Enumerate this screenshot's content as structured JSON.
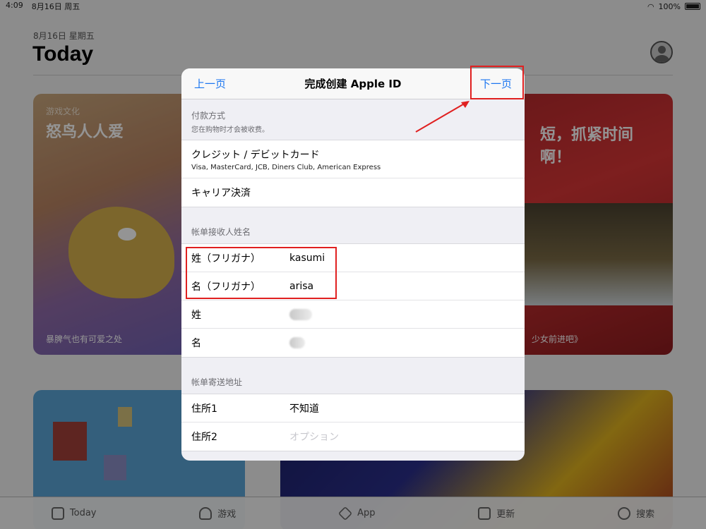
{
  "status_bar": {
    "time": "4:09",
    "date": "8月16日 周五",
    "battery": "100%"
  },
  "header": {
    "date_line": "8月16日 星期五",
    "title": "Today"
  },
  "cards": {
    "left1": {
      "tag": "游戏文化",
      "title": "怒鸟人人爱",
      "bottom": "暴脾气也有可爱之处"
    },
    "right1": {
      "title": "短，抓紧时间\n啊！",
      "bottom": "少女前进吧》"
    }
  },
  "tabbar": {
    "items": [
      {
        "label": "Today",
        "icon": "today-icon"
      },
      {
        "label": "游戏",
        "icon": "rocket-icon"
      },
      {
        "label": "App",
        "icon": "layers-icon"
      },
      {
        "label": "更新",
        "icon": "download-icon"
      },
      {
        "label": "搜索",
        "icon": "search-icon"
      }
    ]
  },
  "modal": {
    "nav": {
      "back_label": "上一页",
      "title": "完成创建 Apple ID",
      "next_label": "下一页"
    },
    "payment": {
      "header": "付款方式",
      "subheader": "您在购物时才会被收费。",
      "options": [
        {
          "title": "クレジット / デビットカード",
          "detail": "Visa, MasterCard, JCB, Diners Club, American Express"
        },
        {
          "title": "キャリア決済"
        }
      ]
    },
    "billing_name": {
      "header": "帐单接收人姓名",
      "rows": [
        {
          "label": "姓（フリガナ）",
          "value": "kasumi"
        },
        {
          "label": "名（フリガナ）",
          "value": "arisa"
        },
        {
          "label": "姓",
          "value": ""
        },
        {
          "label": "名",
          "value": ""
        }
      ]
    },
    "billing_address": {
      "header": "帐单寄送地址",
      "rows": [
        {
          "label": "住所1",
          "value": "不知道"
        },
        {
          "label": "住所2",
          "placeholder": "オプション"
        }
      ]
    }
  },
  "colors": {
    "accent": "#1b76f0",
    "annotation": "#e02020"
  }
}
